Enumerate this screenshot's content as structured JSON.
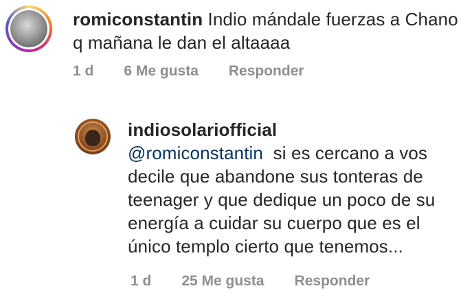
{
  "comment": {
    "username": "romiconstantin",
    "text": "Indio mándale fuerzas a Chano q mañana le dan el altaaaa",
    "time": "1 d",
    "likes": "6 Me gusta",
    "reply_label": "Responder"
  },
  "reply": {
    "username": "indiosolariofficial",
    "mention": "@romiconstantin",
    "text": "si es cercano a vos decile que abandone sus tonteras de teenager y que dedique un poco de su energía a cuidar su cuerpo que es el único templo cierto que tenemos...",
    "time": "1 d",
    "likes": "25 Me gusta",
    "reply_label": "Responder"
  }
}
